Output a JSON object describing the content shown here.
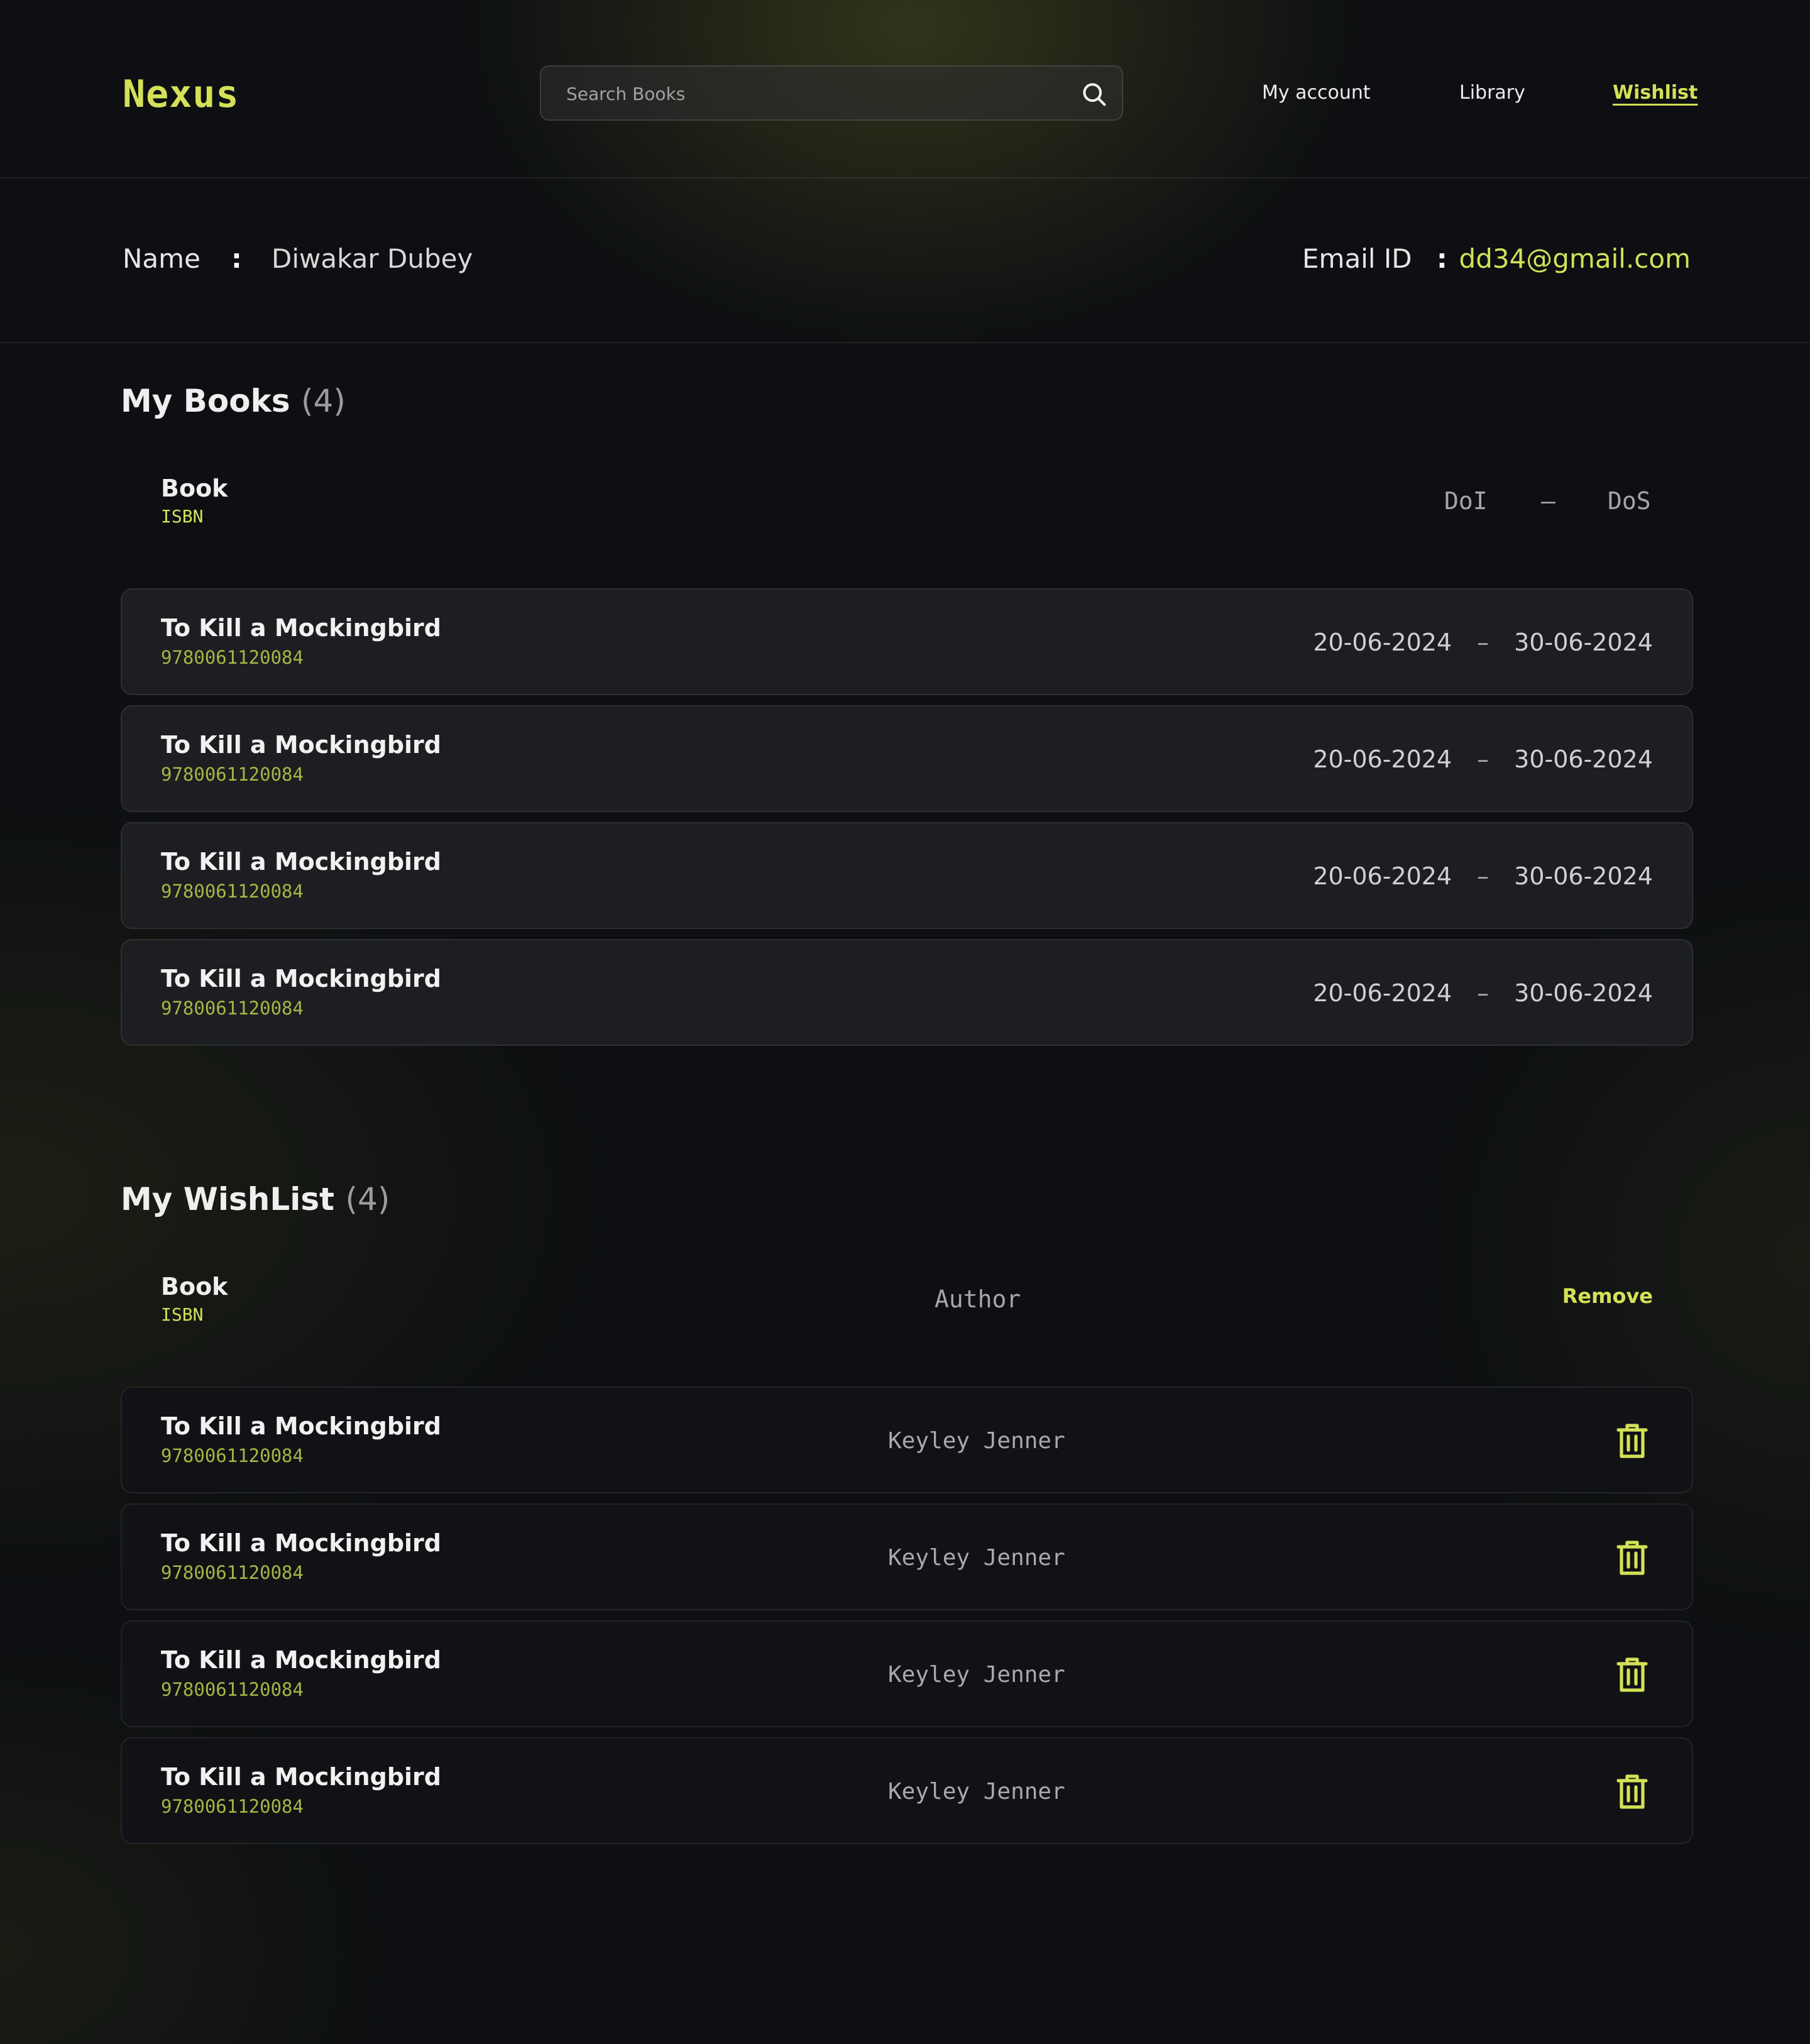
{
  "header": {
    "logo": "Nexus",
    "search_placeholder": "Search Books",
    "nav": {
      "my_account": "My account",
      "library": "Library",
      "wishlist": "Wishlist"
    }
  },
  "profile": {
    "name_label": "Name",
    "name_value": "Diwakar Dubey",
    "email_label": "Email ID",
    "email_value": "dd34@gmail.com",
    "separator": ":"
  },
  "my_books": {
    "title": "My Books",
    "count": "(4)",
    "headers": {
      "book": "Book",
      "isbn": "ISBN",
      "doi": "DoI",
      "dash": "–",
      "dos": "DoS"
    },
    "rows": [
      {
        "title": "To Kill a Mockingbird",
        "isbn": "9780061120084",
        "doi": "20-06-2024",
        "dos": "30-06-2024"
      },
      {
        "title": "To Kill a Mockingbird",
        "isbn": "9780061120084",
        "doi": "20-06-2024",
        "dos": "30-06-2024"
      },
      {
        "title": "To Kill a Mockingbird",
        "isbn": "9780061120084",
        "doi": "20-06-2024",
        "dos": "30-06-2024"
      },
      {
        "title": "To Kill a Mockingbird",
        "isbn": "9780061120084",
        "doi": "20-06-2024",
        "dos": "30-06-2024"
      }
    ],
    "row_dash": "–"
  },
  "wishlist": {
    "title": "My WishList",
    "count": "(4)",
    "headers": {
      "book": "Book",
      "isbn": "ISBN",
      "author": "Author",
      "remove": "Remove"
    },
    "rows": [
      {
        "title": "To Kill a Mockingbird",
        "isbn": "9780061120084",
        "author": "Keyley Jenner",
        "icon": "trash-icon"
      },
      {
        "title": "To Kill a Mockingbird",
        "isbn": "9780061120084",
        "author": "Keyley Jenner",
        "icon": "trash-icon"
      },
      {
        "title": "To Kill a Mockingbird",
        "isbn": "9780061120084",
        "author": "Keyley Jenner",
        "icon": "trash-icon"
      },
      {
        "title": "To Kill a Mockingbird",
        "isbn": "9780061120084",
        "author": "Keyley Jenner",
        "icon": "trash-icon"
      }
    ]
  },
  "colors": {
    "accent": "#d4e157",
    "isbn": "#a9b444",
    "background": "#0d0f12",
    "book_row": "#1c1e21",
    "wish_row": "#101215"
  },
  "icons": {
    "search": "search-icon",
    "remove": "trash-icon"
  }
}
